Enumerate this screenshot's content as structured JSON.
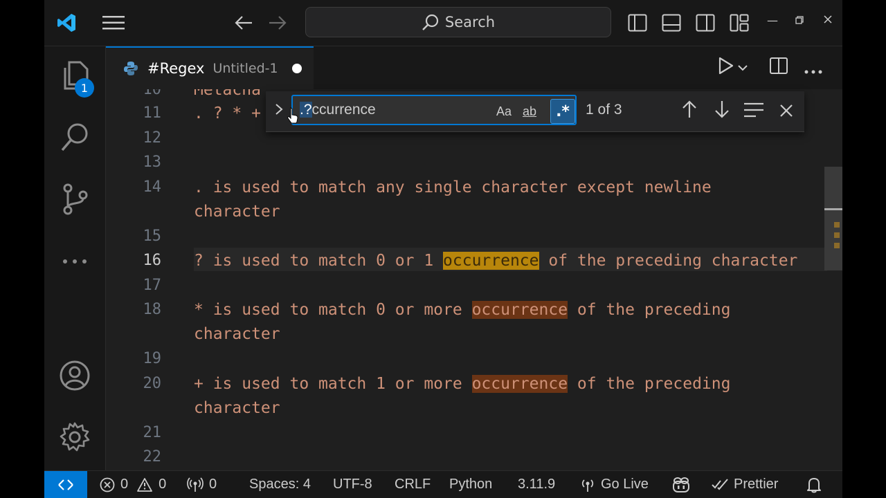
{
  "titlebar": {
    "search_placeholder": "Search",
    "icons": [
      "vscode-logo",
      "hamburger-menu",
      "back-arrow",
      "forward-arrow",
      "toggle-primary-sidebar",
      "toggle-panel",
      "toggle-secondary-sidebar",
      "customize-layout",
      "minimize",
      "restore",
      "close"
    ]
  },
  "activity_bar": {
    "explorer_badge": "1",
    "items": [
      "explorer",
      "search",
      "source-control",
      "more",
      "accounts",
      "manage"
    ]
  },
  "tab": {
    "title": "#Regex",
    "subtitle": "Untitled-1",
    "language_icon": "python"
  },
  "find_widget": {
    "query_selected": ".?",
    "query_rest": "ccurrence",
    "match_case_label": "Aa",
    "whole_word_label": "ab",
    "regex_label": ".*",
    "regex_enabled": true,
    "match_count": "1 of 3"
  },
  "editor": {
    "lines": [
      {
        "num": "10",
        "text": "Metacha"
      },
      {
        "num": "11",
        "text": ". ? * +"
      },
      {
        "num": "12",
        "text": ""
      },
      {
        "num": "13",
        "text": ""
      },
      {
        "num": "14",
        "text": ". is used to match any single character except newline",
        "wrap": "character"
      },
      {
        "num": "15",
        "text": ""
      },
      {
        "num": "16",
        "pre": "? is used to match 0 or 1 ",
        "match": "occurrence",
        "post": " of the preceding character",
        "active": true
      },
      {
        "num": "17",
        "text": ""
      },
      {
        "num": "18",
        "pre": "* is used to match 0 or more ",
        "match": "occurrence",
        "post": " of the preceding",
        "wrap": "character"
      },
      {
        "num": "19",
        "text": ""
      },
      {
        "num": "20",
        "pre": "+ is used to match 1 or more ",
        "match": "occurrence",
        "post": " of the preceding",
        "wrap": "character"
      },
      {
        "num": "21",
        "text": ""
      },
      {
        "num": "22",
        "text": ""
      }
    ]
  },
  "statusbar": {
    "errors": "0",
    "warnings": "0",
    "ports": "0",
    "spaces": "Spaces: 4",
    "encoding": "UTF-8",
    "eol": "CRLF",
    "language": "Python",
    "python_version": "3.11.9",
    "go_live": "Go Live",
    "prettier": "Prettier"
  },
  "colors": {
    "accent": "#0078d4",
    "string": "#ce9178",
    "current_match": "#b8860b",
    "other_match": "#6b3415"
  }
}
